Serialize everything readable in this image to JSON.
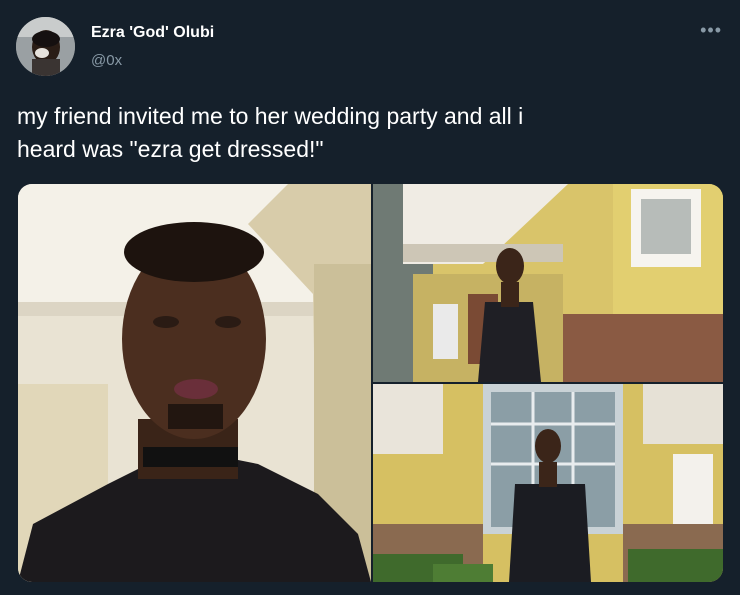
{
  "author": {
    "display_name": "Ezra 'God' Olubi",
    "handle": "@0x",
    "avatar_icon": "user-avatar"
  },
  "menu": {
    "more_icon": "more-horizontal-icon",
    "more_label": "•••"
  },
  "tweet": {
    "text_line1": "my friend invited me to her wedding party and all i",
    "text_line2": "heard was \"ezra get dressed!\""
  },
  "colors": {
    "background": "#15202b",
    "primary_text": "#ffffff",
    "secondary_text": "#8899a6"
  }
}
